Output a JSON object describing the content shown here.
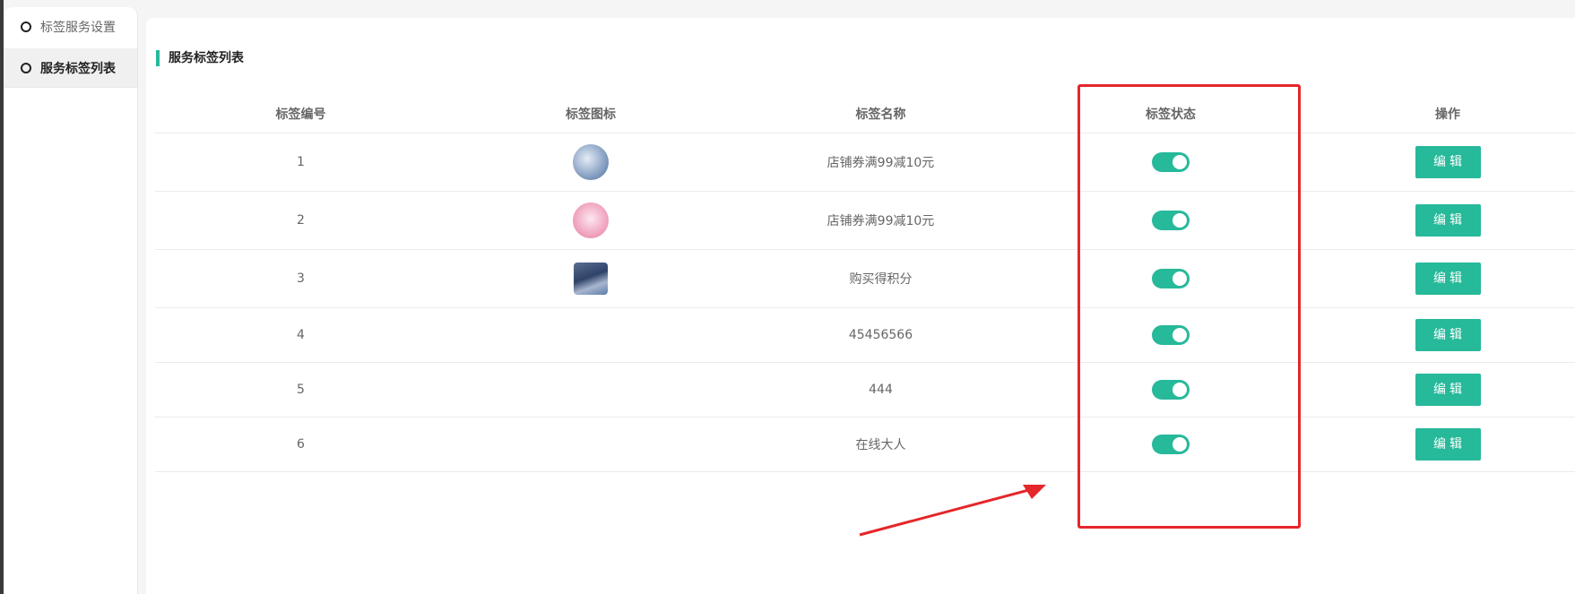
{
  "sidebar": {
    "items": [
      {
        "label": "标签服务设置",
        "active": false
      },
      {
        "label": "服务标签列表",
        "active": true
      }
    ]
  },
  "main": {
    "title": "服务标签列表",
    "table": {
      "headers": [
        "标签编号",
        "标签图标",
        "标签名称",
        "标签状态",
        "操作"
      ],
      "rows": [
        {
          "id": "1",
          "icon": "tag-image-1",
          "name": "店铺券满99减10元",
          "status": "on",
          "action": "编辑"
        },
        {
          "id": "2",
          "icon": "tag-image-2",
          "name": "店铺券满99减10元",
          "status": "on",
          "action": "编辑"
        },
        {
          "id": "3",
          "icon": "tag-image-3",
          "name": "购买得积分",
          "status": "on",
          "action": "编辑"
        },
        {
          "id": "4",
          "icon": "",
          "name": "45456566",
          "status": "on",
          "action": "编辑"
        },
        {
          "id": "5",
          "icon": "",
          "name": "444",
          "status": "on",
          "action": "编辑"
        },
        {
          "id": "6",
          "icon": "",
          "name": "在线大人",
          "status": "on",
          "action": "编辑"
        }
      ]
    }
  },
  "colors": {
    "accent": "#26b99a",
    "annotation": "#e5262a"
  }
}
